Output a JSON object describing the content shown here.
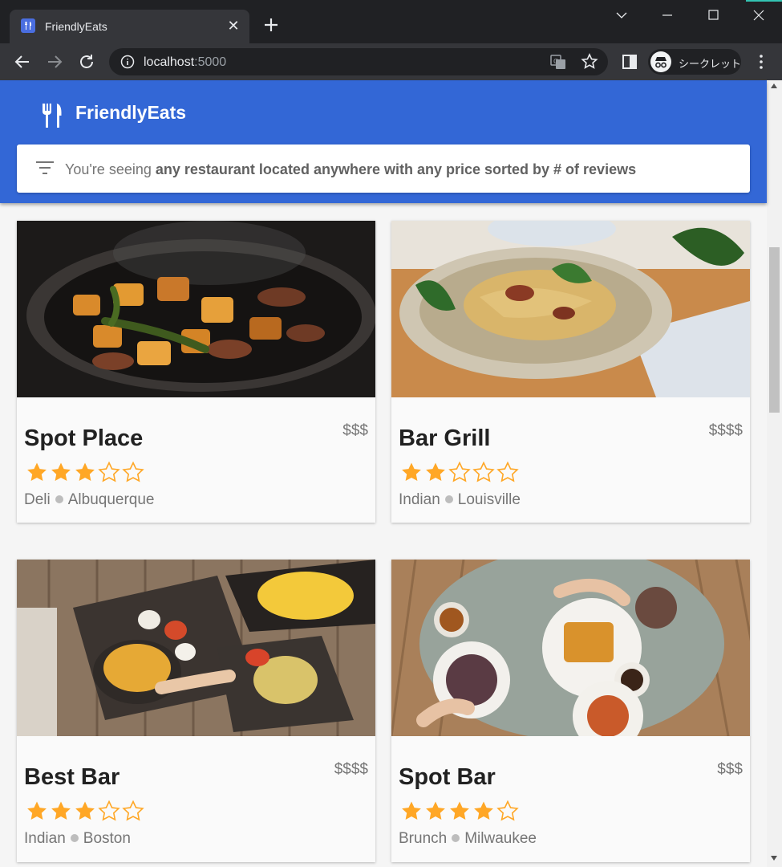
{
  "browser": {
    "tab_title": "FriendlyEats",
    "url_host": "localhost",
    "url_port": ":5000",
    "incognito_label": "シークレット"
  },
  "app": {
    "brand": "FriendlyEats",
    "accent_color": "#3367d6",
    "filter": {
      "prefix": "You're seeing ",
      "summary": "any restaurant located anywhere with any price sorted by # of reviews"
    }
  },
  "restaurants": [
    {
      "name": "Spot Place",
      "price": "$$$",
      "rating": 3,
      "category": "Deli",
      "city": "Albuquerque",
      "photo": "pan of roasted vegetables and chicken"
    },
    {
      "name": "Bar Grill",
      "price": "$$$$",
      "rating": 2,
      "category": "Indian",
      "city": "Louisville",
      "photo": "bowl of pasta with herbs"
    },
    {
      "name": "Best Bar",
      "price": "$$$$",
      "rating": 3,
      "category": "Indian",
      "city": "Boston",
      "photo": "table of fries, dips and nachos"
    },
    {
      "name": "Spot Bar",
      "price": "$$$",
      "rating": 4,
      "category": "Brunch",
      "city": "Milwaukee",
      "photo": "brunch table with waffles and coffee"
    }
  ],
  "star_color": "#ffa726"
}
